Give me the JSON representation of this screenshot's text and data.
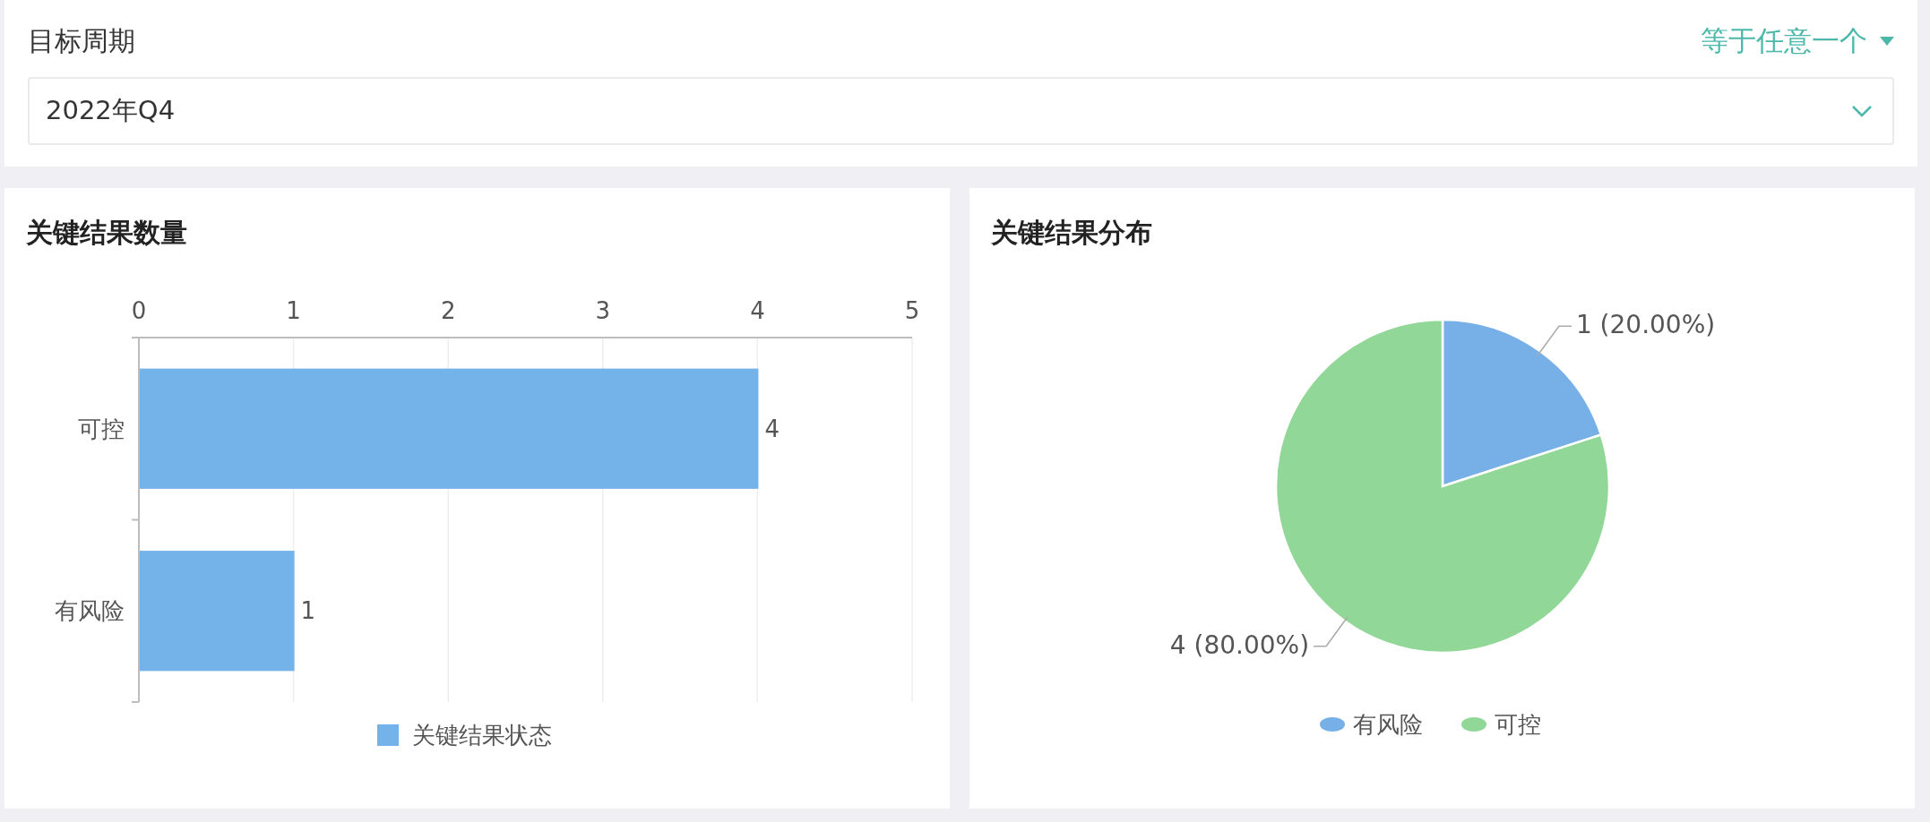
{
  "filter": {
    "label": "目标周期",
    "operator": "等于任意一个",
    "value": "2022年Q4"
  },
  "bar_panel": {
    "title": "关键结果数量",
    "chart_data": {
      "type": "bar",
      "orientation": "horizontal",
      "categories": [
        "可控",
        "有风险"
      ],
      "series": [
        {
          "name": "关键结果状态",
          "color": "#74b3ea",
          "values": [
            4,
            1
          ]
        }
      ],
      "xlim": [
        0,
        5
      ],
      "xticks": [
        0,
        1,
        2,
        3,
        4,
        5
      ],
      "data_labels": true,
      "grid": true,
      "legend": true
    }
  },
  "pie_panel": {
    "title": "关键结果分布",
    "chart_data": {
      "type": "pie",
      "categories": [
        "有风险",
        "可控"
      ],
      "values": [
        1,
        4
      ],
      "legend": true,
      "colors": [
        "#76b0e6",
        "#91d797"
      ],
      "value_labels": [
        "1 (20.00%)",
        "4 (80.00%)"
      ]
    }
  }
}
